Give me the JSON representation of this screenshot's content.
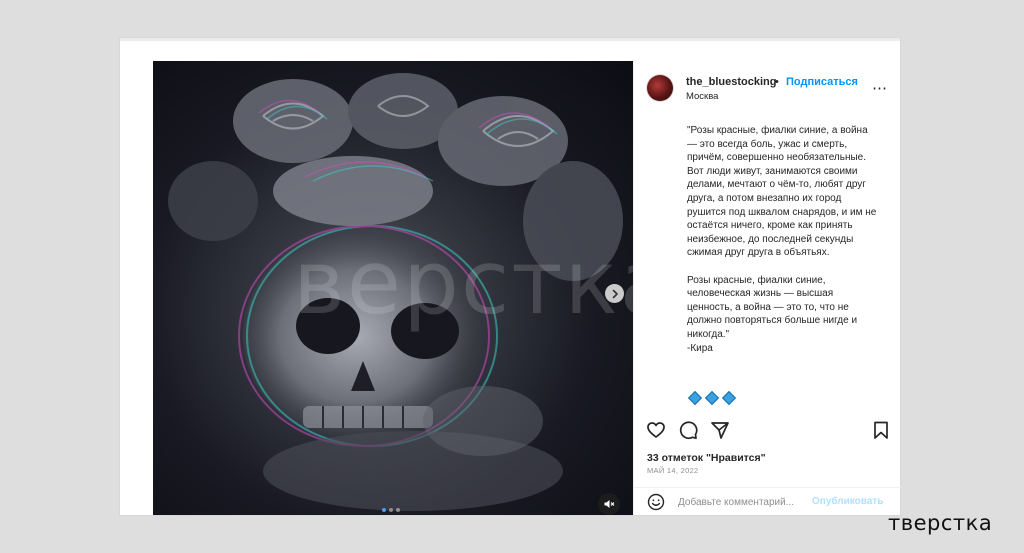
{
  "post": {
    "username": "the_bluestocking",
    "separator": "•",
    "follow_label": "Подписаться",
    "location": "Москва",
    "more_icon": "⋯",
    "caption": "\"Розы красные, фиалки синие, а война — это всегда боль, ужас и смерть, причём, совершенно необязательные. Вот люди живут, занимаются своими делами, мечтают о чём-то, любят друг друга, а потом внезапно их город рушится под шквалом снарядов, и им не остаётся ничего, кроме как принять неизбежное, до последней секунды сжимая друг друга в объятьях.\n\nРозы красные, фиалки синие, человеческая жизнь — высшая ценность, а война — это то, что не должно повторяться больше нигде и никогда.\"\n-Кира",
    "emoji_icons": [
      "blue-diamond-icon",
      "blue-diamond-icon",
      "blue-diamond-icon"
    ],
    "likes": "33 отметок \"Нравится\"",
    "date": "МАЙ 14, 2022",
    "comment_placeholder": "Добавьте комментарий...",
    "publish_label": "Опубликовать"
  },
  "media": {
    "watermark": "верстка",
    "slides_total": 3,
    "slide_active": 1
  },
  "brand": "тверстка",
  "colors": {
    "accent": "#0095f6",
    "publish_disabled": "#b2dffc",
    "emoji": "#3aa0e0"
  }
}
